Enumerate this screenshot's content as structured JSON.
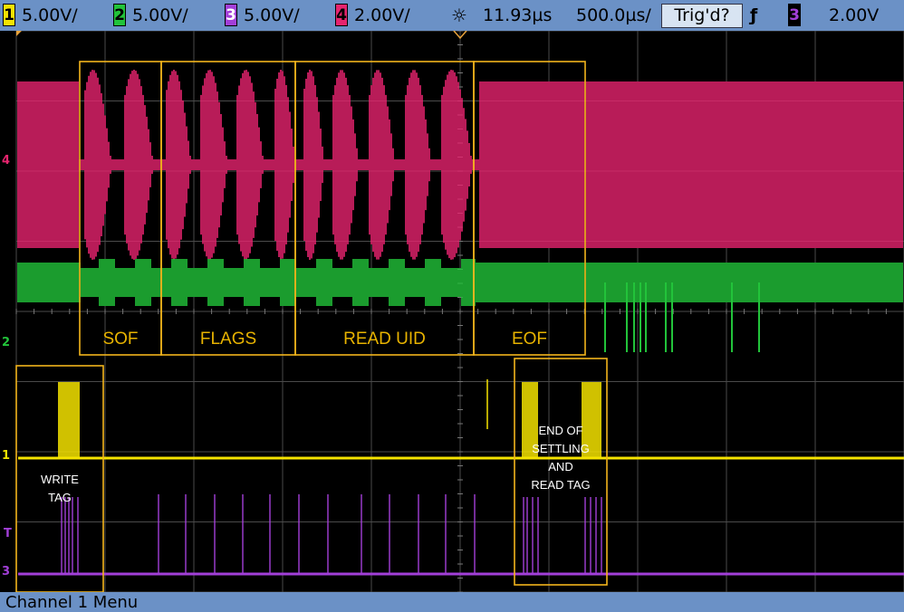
{
  "status_bar": {
    "ch1": {
      "number": "1",
      "scale": "5.00V/",
      "color": "#f5e300"
    },
    "ch2": {
      "number": "2",
      "scale": "5.00V/",
      "color": "#22c33a"
    },
    "ch3": {
      "number": "3",
      "scale": "5.00V/",
      "color": "#a23fd8"
    },
    "ch4": {
      "number": "4",
      "scale": "2.00V/",
      "color": "#e6246e"
    },
    "acq_icon": "sun-burst-icon",
    "time_delay": "11.93µs",
    "time_scale": "500.0µs/",
    "trigger_status": "Trig'd?",
    "trigger_edge_icon": "rising-edge-icon",
    "trigger_source": "3",
    "trigger_level": "2.00V"
  },
  "bottom_bar": {
    "menu_label": "Channel 1  Menu"
  },
  "channel_markers": {
    "ch4": "4",
    "ch2": "2",
    "ch1": "1",
    "trig": "T",
    "ch3": "3"
  },
  "annotations": {
    "sof": "SOF",
    "flags": "FLAGS",
    "read_uid": "READ UID",
    "eof": "EOF",
    "write_tag_line1": "WRITE",
    "write_tag_line2": "TAG",
    "settle_line1": "END OF",
    "settle_line2": "SETTLING",
    "settle_line3": "AND",
    "settle_line4": "READ TAG"
  },
  "colors": {
    "ch1": "#f5e300",
    "ch2": "#22c33a",
    "ch3": "#a23fd8",
    "ch4": "#e6246e",
    "annotation_box": "#f2b51c",
    "grid": "#4a4a4a"
  }
}
